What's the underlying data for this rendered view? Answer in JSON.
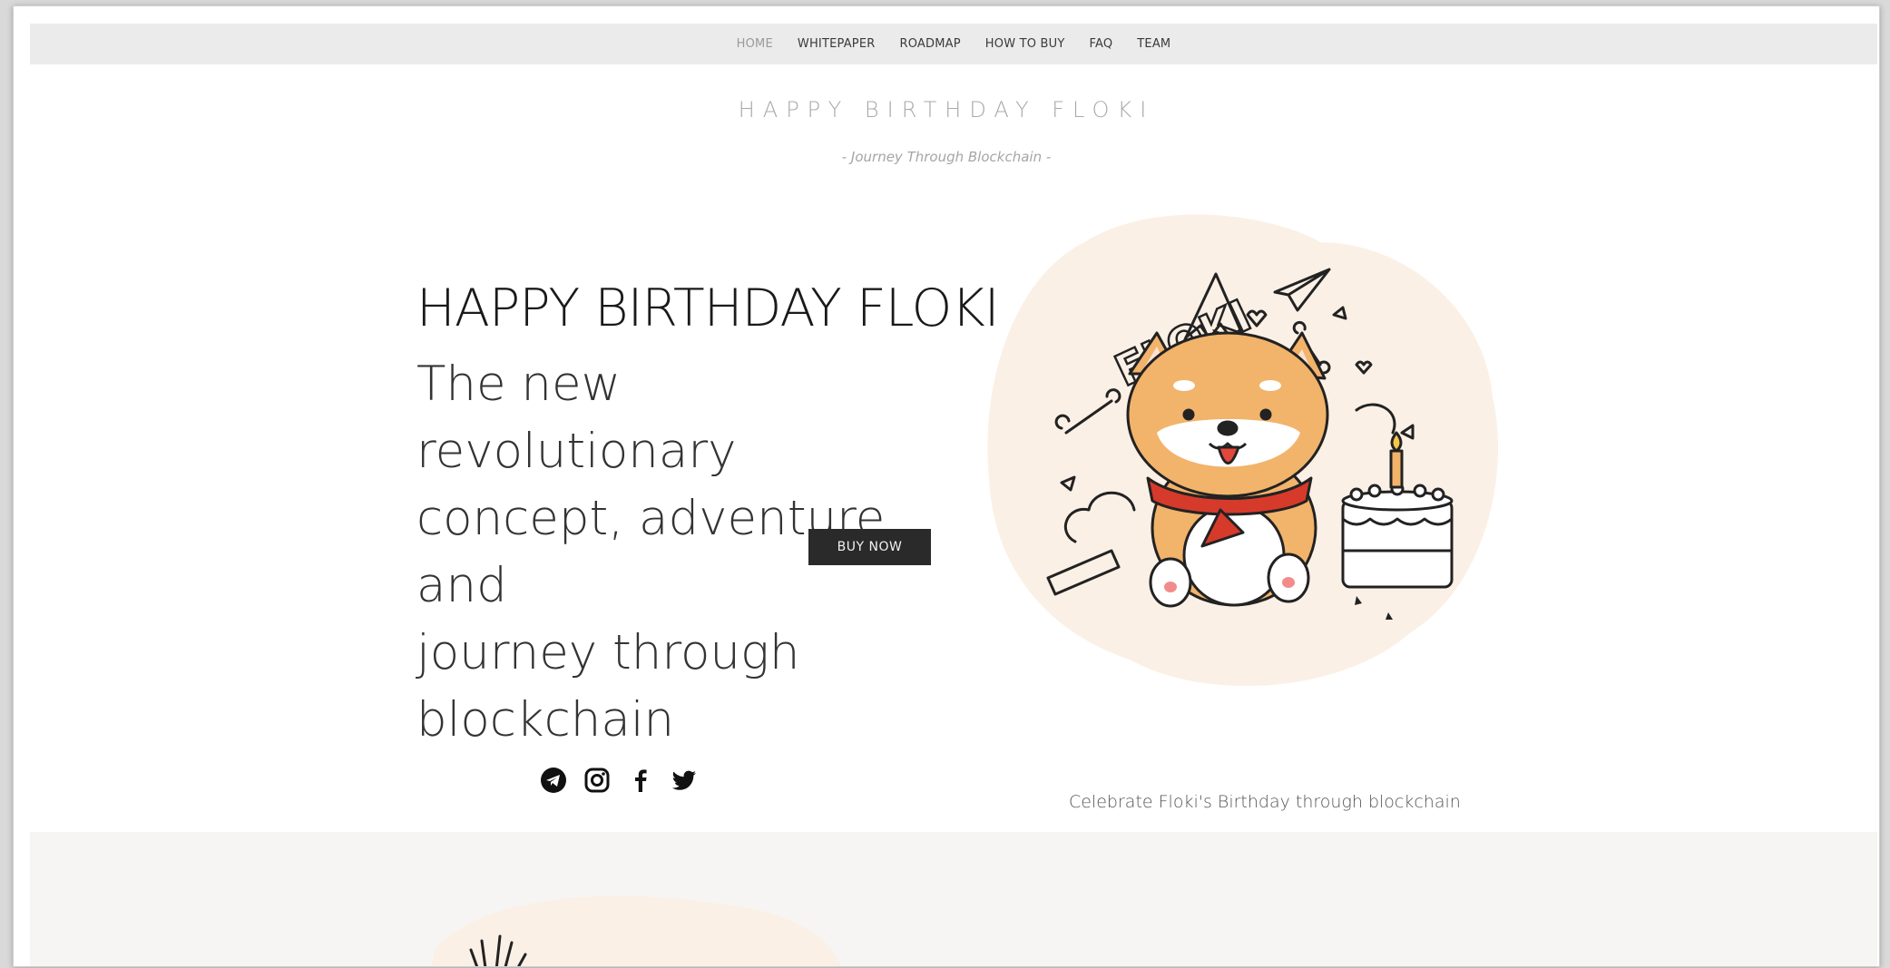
{
  "nav": {
    "items": [
      {
        "label": "HOME"
      },
      {
        "label": "WHITEPAPER"
      },
      {
        "label": "ROADMAP"
      },
      {
        "label": "HOW TO BUY"
      },
      {
        "label": "FAQ"
      },
      {
        "label": "TEAM"
      }
    ],
    "active": "HOME"
  },
  "header": {
    "title": "HAPPY BIRTHDAY FLOKI",
    "subtitle": "- Journey Through Blockchain -"
  },
  "hero": {
    "heading": "HAPPY BIRTHDAY FLOKI",
    "body": "The new revolutionary\nconcept, adventure and\njourney through\nblockchain",
    "buy_button": "BUY NOW",
    "illustration_text": "FLOKI"
  },
  "social": {
    "icons": [
      "telegram-icon",
      "instagram-icon",
      "facebook-icon",
      "twitter-icon"
    ]
  },
  "footer_strip": {
    "tagline": "Celebrate Floki's Birthday through blockchain"
  },
  "colors": {
    "nav_bg": "#ebebeb",
    "button_bg": "#2a2a2a",
    "art_blob": "#fbf0e6",
    "dog_orange": "#f2b36b",
    "bandana_red": "#d63a2a"
  }
}
